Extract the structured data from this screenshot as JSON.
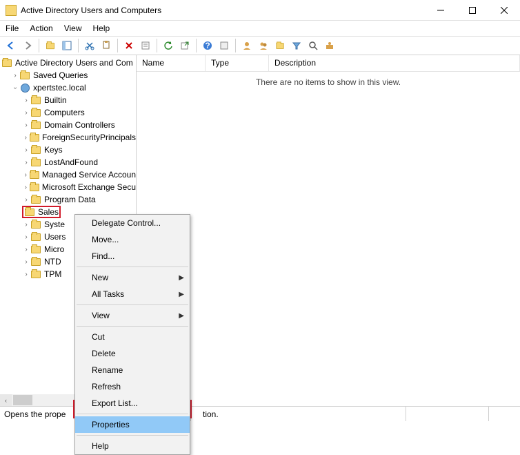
{
  "window": {
    "title": "Active Directory Users and Computers"
  },
  "menubar": {
    "file": "File",
    "action": "Action",
    "view": "View",
    "help": "Help"
  },
  "tree": {
    "root": "Active Directory Users and Com",
    "saved_queries": "Saved Queries",
    "domain": "xpertstec.local",
    "items": [
      "Builtin",
      "Computers",
      "Domain Controllers",
      "ForeignSecurityPrincipals",
      "Keys",
      "LostAndFound",
      "Managed Service Accoun",
      "Microsoft Exchange Secu",
      "Program Data",
      "Sales",
      "Syste",
      "Users",
      "Micro",
      "NTD",
      "TPM"
    ]
  },
  "columns": {
    "name": "Name",
    "type": "Type",
    "desc": "Description"
  },
  "empty_text": "There are no items to show in this view.",
  "context": {
    "delegate": "Delegate Control...",
    "move": "Move...",
    "find": "Find...",
    "new": "New",
    "all_tasks": "All Tasks",
    "view": "View",
    "cut": "Cut",
    "delete": "Delete",
    "rename": "Rename",
    "refresh": "Refresh",
    "export": "Export List...",
    "properties": "Properties",
    "help": "Help"
  },
  "status": {
    "hint_left": "Opens the prope",
    "hint_right": "tion."
  }
}
